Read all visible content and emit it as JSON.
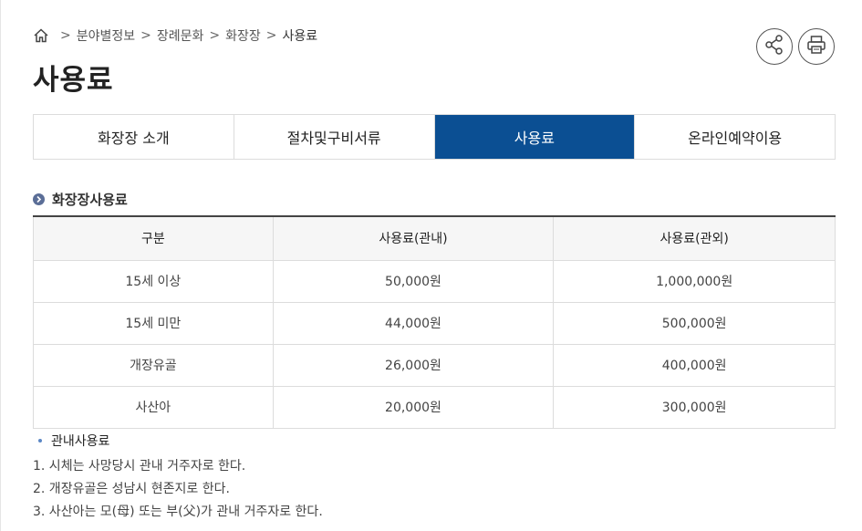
{
  "breadcrumb": {
    "items": [
      "분야별정보",
      "장례문화",
      "화장장",
      "사용료"
    ],
    "separator": ">"
  },
  "page": {
    "title": "사용료"
  },
  "actions": {
    "share_icon": "share-icon",
    "print_icon": "print-icon"
  },
  "tabs": [
    {
      "label": "화장장 소개",
      "active": false
    },
    {
      "label": "절차및구비서류",
      "active": false
    },
    {
      "label": "사용료",
      "active": true
    },
    {
      "label": "온라인예약이용",
      "active": false
    }
  ],
  "section": {
    "title": "화장장사용료"
  },
  "table": {
    "headers": [
      "구분",
      "사용료(관내)",
      "사용료(관외)"
    ],
    "rows": [
      [
        "15세 이상",
        "50,000원",
        "1,000,000원"
      ],
      [
        "15세 미만",
        "44,000원",
        "500,000원"
      ],
      [
        "개장유골",
        "26,000원",
        "400,000원"
      ],
      [
        "사산아",
        "20,000원",
        "300,000원"
      ]
    ]
  },
  "notes": {
    "title": "관내사용료",
    "items": [
      "1. 시체는 사망당시 관내 거주자로 한다.",
      "2. 개장유골은 성남시 현존지로 한다.",
      "3. 사산아는 모(母) 또는 부(父)가 관내 거주자로 한다."
    ]
  },
  "colors": {
    "accent": "#0b4f93",
    "bullet": "#5b6e97"
  }
}
